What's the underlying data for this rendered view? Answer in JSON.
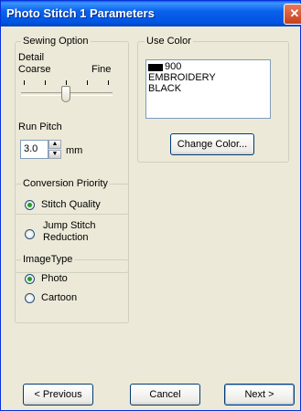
{
  "window": {
    "title": "Photo Stitch 1 Parameters",
    "close_glyph": "✕"
  },
  "sewing": {
    "legend": "Sewing Option",
    "detail_label": "Detail",
    "coarse_label": "Coarse",
    "fine_label": "Fine",
    "run_pitch_label": "Run Pitch",
    "run_pitch_value": "3.0",
    "unit": "mm"
  },
  "use_color": {
    "legend": "Use Color",
    "code": "900",
    "line2": "EMBROIDERY",
    "line3": "BLACK",
    "swatch_color": "#000000",
    "change_label": "Change Color..."
  },
  "conversion": {
    "legend": "Conversion Priority",
    "opt1": "Stitch Quality",
    "opt2a": "Jump Stitch",
    "opt2b": "Reduction",
    "selected": "Stitch Quality"
  },
  "imagetype": {
    "legend": "ImageType",
    "opt1": "Photo",
    "opt2": "Cartoon",
    "selected": "Photo"
  },
  "footer": {
    "previous": "< Previous",
    "cancel": "Cancel",
    "next": "Next >"
  }
}
